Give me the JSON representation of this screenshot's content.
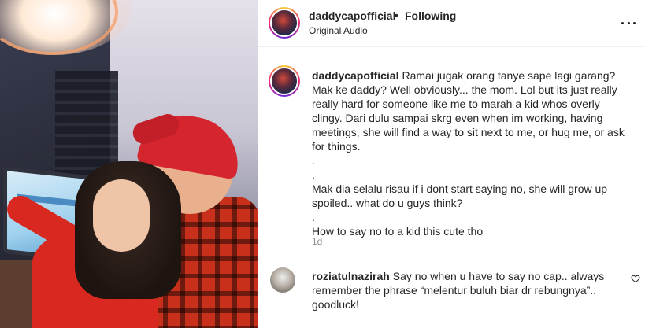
{
  "header": {
    "username": "daddycapofficial",
    "separator": "•",
    "follow_status": "Following",
    "audio": "Original Audio",
    "more_icon": "more-horizontal-icon"
  },
  "caption": {
    "username": "daddycapofficial",
    "lines": [
      "Ramai jugak orang tanye sape lagi garang? Mak ke daddy? Well obviously... the mom. Lol but its just really really hard for someone like me to marah a kid whos overly clingy. Dari dulu sampai skrg even when im working, having meetings, she will find a way to sit next to me, or hug me, or ask for things.",
      ".",
      ".",
      "Mak dia selalu risau if i dont start saying no, she will grow up spoiled.. what do u guys think?",
      ".",
      "How to say no to a kid this cute tho"
    ],
    "timestamp": "1d"
  },
  "comment": {
    "username": "roziatulnazirah",
    "text": "Say no when u have to say no cap.. always remember the phrase “melentur buluh biar dr rebungnya”.. goodluck!",
    "like_icon": "heart-icon"
  }
}
